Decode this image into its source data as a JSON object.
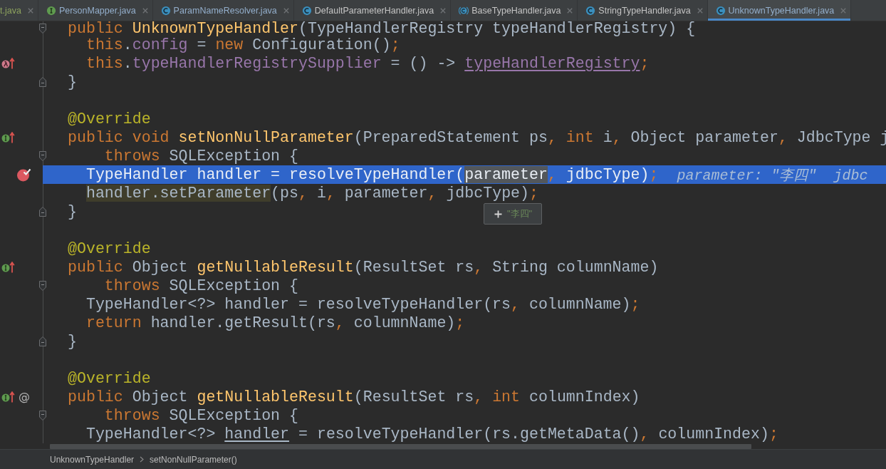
{
  "tabs": [
    {
      "label": "t.java",
      "kind": "plain",
      "color": "#8da25e",
      "selected": false
    },
    {
      "label": "PersonMapper.java",
      "kind": "interface",
      "color": "#93aecb",
      "selected": false
    },
    {
      "label": "ParamNameResolver.java",
      "kind": "class",
      "color": "#93aecb",
      "selected": false
    },
    {
      "label": "DefaultParameterHandler.java",
      "kind": "class",
      "color": "#c4c4c4",
      "selected": false
    },
    {
      "label": "BaseTypeHandler.java",
      "kind": "abstract_class",
      "color": "#c4c4c4",
      "selected": false
    },
    {
      "label": "StringTypeHandler.java",
      "kind": "class",
      "color": "#c4c4c4",
      "selected": false
    },
    {
      "label": "UnknownTypeHandler.java",
      "kind": "class",
      "color": "#93aecb",
      "selected": true
    }
  ],
  "editor": {
    "lines": [
      {
        "fold": {
          "kind": "start"
        },
        "selected": false,
        "tokens": [
          {
            "kind": "keyword",
            "text": "public "
          },
          {
            "kind": "declaration",
            "text": "UnknownTypeHandler"
          },
          {
            "kind": "plain",
            "text": "(TypeHandlerRegistry typeHandlerRegistry) {"
          }
        ]
      },
      {
        "selected": false,
        "tokens": [
          {
            "kind": "keyword",
            "text": "  this"
          },
          {
            "kind": "plain",
            "text": "."
          },
          {
            "kind": "field",
            "text": "config"
          },
          {
            "kind": "plain",
            "text": " = "
          },
          {
            "kind": "keyword",
            "text": "new"
          },
          {
            "kind": "plain",
            "text": " Configuration()"
          },
          {
            "kind": "punct",
            "text": ";"
          }
        ]
      },
      {
        "selected": false,
        "markers": [
          {
            "kind": "lambda_override"
          }
        ],
        "tokens": [
          {
            "kind": "keyword",
            "text": "  this"
          },
          {
            "kind": "plain",
            "text": "."
          },
          {
            "kind": "field",
            "text": "typeHandlerRegistrySupplier"
          },
          {
            "kind": "plain",
            "text": " = () -> "
          },
          {
            "kind": "param_ref",
            "text": "typeHandlerRegistry"
          },
          {
            "kind": "punct",
            "text": ";"
          }
        ]
      },
      {
        "fold": {
          "kind": "end"
        },
        "selected": false,
        "tokens": [
          {
            "kind": "plain",
            "text": "}"
          }
        ]
      },
      {
        "selected": false
      },
      {
        "selected": false,
        "tokens": [
          {
            "kind": "annotation",
            "text": "@Override"
          }
        ]
      },
      {
        "selected": false,
        "markers": [
          {
            "kind": "implements"
          }
        ],
        "tokens": [
          {
            "kind": "keyword",
            "text": "public void "
          },
          {
            "kind": "declaration",
            "text": "setNonNullParameter"
          },
          {
            "kind": "plain",
            "text": "(PreparedStatement ps"
          },
          {
            "kind": "punct",
            "text": ","
          },
          {
            "kind": "keyword",
            "text": " int"
          },
          {
            "kind": "plain",
            "text": " i"
          },
          {
            "kind": "punct",
            "text": ","
          },
          {
            "kind": "plain",
            "text": " Object parameter"
          },
          {
            "kind": "punct",
            "text": ","
          },
          {
            "kind": "plain",
            "text": " JdbcType j"
          }
        ]
      },
      {
        "fold": {
          "kind": "start"
        },
        "selected": false,
        "tokens": [
          {
            "kind": "keyword",
            "text": "    throws"
          },
          {
            "kind": "plain",
            "text": " SQLException {"
          }
        ]
      },
      {
        "selected": true,
        "markers": [
          {
            "kind": "breakpoint"
          }
        ],
        "tokens": [
          {
            "kind": "plain",
            "text": "  TypeHandler handler = resolveTypeHandler("
          },
          {
            "kind": "hovered",
            "text": "parameter",
            "tooltip": "\"李四\""
          },
          {
            "kind": "punct",
            "text": ","
          },
          {
            "kind": "plain",
            "text": " jdbcType)"
          },
          {
            "kind": "punct",
            "text": ";"
          }
        ],
        "hint": "parameter: \"李四\"  jdbc"
      },
      {
        "selected": false,
        "tokens": [
          {
            "kind": "step",
            "text": "  handler.setParameter"
          },
          {
            "kind": "plain",
            "text": "(ps"
          },
          {
            "kind": "punct",
            "text": ","
          },
          {
            "kind": "plain",
            "text": " i"
          },
          {
            "kind": "punct",
            "text": ","
          },
          {
            "kind": "plain",
            "text": " parameter"
          },
          {
            "kind": "punct",
            "text": ","
          },
          {
            "kind": "plain",
            "text": " jdbcType)"
          },
          {
            "kind": "punct",
            "text": ";"
          }
        ]
      },
      {
        "fold": {
          "kind": "end"
        },
        "selected": false,
        "tokens": [
          {
            "kind": "plain",
            "text": "}"
          }
        ]
      },
      {
        "selected": false
      },
      {
        "selected": false,
        "tokens": [
          {
            "kind": "annotation",
            "text": "@Override"
          }
        ]
      },
      {
        "selected": false,
        "markers": [
          {
            "kind": "implements"
          }
        ],
        "tokens": [
          {
            "kind": "keyword",
            "text": "public"
          },
          {
            "kind": "plain",
            "text": " Object "
          },
          {
            "kind": "declaration",
            "text": "getNullableResult"
          },
          {
            "kind": "plain",
            "text": "(ResultSet rs"
          },
          {
            "kind": "punct",
            "text": ","
          },
          {
            "kind": "plain",
            "text": " String columnName)"
          }
        ]
      },
      {
        "fold": {
          "kind": "start"
        },
        "selected": false,
        "tokens": [
          {
            "kind": "keyword",
            "text": "    throws"
          },
          {
            "kind": "plain",
            "text": " SQLException {"
          }
        ]
      },
      {
        "selected": false,
        "tokens": [
          {
            "kind": "plain",
            "text": "  TypeHandler<?> handler = resolveTypeHandler(rs"
          },
          {
            "kind": "punct",
            "text": ","
          },
          {
            "kind": "plain",
            "text": " columnName)"
          },
          {
            "kind": "punct",
            "text": ";"
          }
        ]
      },
      {
        "selected": false,
        "tokens": [
          {
            "kind": "keyword",
            "text": "  return"
          },
          {
            "kind": "plain",
            "text": " handler.getResult(rs"
          },
          {
            "kind": "punct",
            "text": ","
          },
          {
            "kind": "plain",
            "text": " columnName)"
          },
          {
            "kind": "punct",
            "text": ";"
          }
        ]
      },
      {
        "fold": {
          "kind": "end"
        },
        "selected": false,
        "tokens": [
          {
            "kind": "plain",
            "text": "}"
          }
        ]
      },
      {
        "selected": false
      },
      {
        "selected": false,
        "tokens": [
          {
            "kind": "annotation",
            "text": "@Override"
          }
        ]
      },
      {
        "selected": false,
        "markers": [
          {
            "kind": "implements"
          },
          {
            "kind": "glyph",
            "text": "@"
          }
        ],
        "tokens": [
          {
            "kind": "keyword",
            "text": "public"
          },
          {
            "kind": "plain",
            "text": " Object "
          },
          {
            "kind": "declaration",
            "text": "getNullableResult"
          },
          {
            "kind": "plain",
            "text": "(ResultSet rs"
          },
          {
            "kind": "punct",
            "text": ","
          },
          {
            "kind": "keyword",
            "text": " int"
          },
          {
            "kind": "plain",
            "text": " columnIndex)"
          }
        ]
      },
      {
        "fold": {
          "kind": "start"
        },
        "selected": false,
        "tokens": [
          {
            "kind": "keyword",
            "text": "    throws"
          },
          {
            "kind": "plain",
            "text": " SQLException {"
          }
        ]
      },
      {
        "selected": false,
        "tokens": [
          {
            "kind": "plain",
            "text": "  TypeHandler<?> "
          },
          {
            "kind": "reassigned",
            "text": "handler"
          },
          {
            "kind": "plain",
            "text": " = resolveTypeHandler(rs.getMetaData()"
          },
          {
            "kind": "punct",
            "text": ","
          },
          {
            "kind": "plain",
            "text": " columnIndex)"
          },
          {
            "kind": "punct",
            "text": ";"
          }
        ]
      }
    ]
  },
  "breadcrumbs": [
    "UnknownTypeHandler",
    "setNonNullParameter()"
  ]
}
